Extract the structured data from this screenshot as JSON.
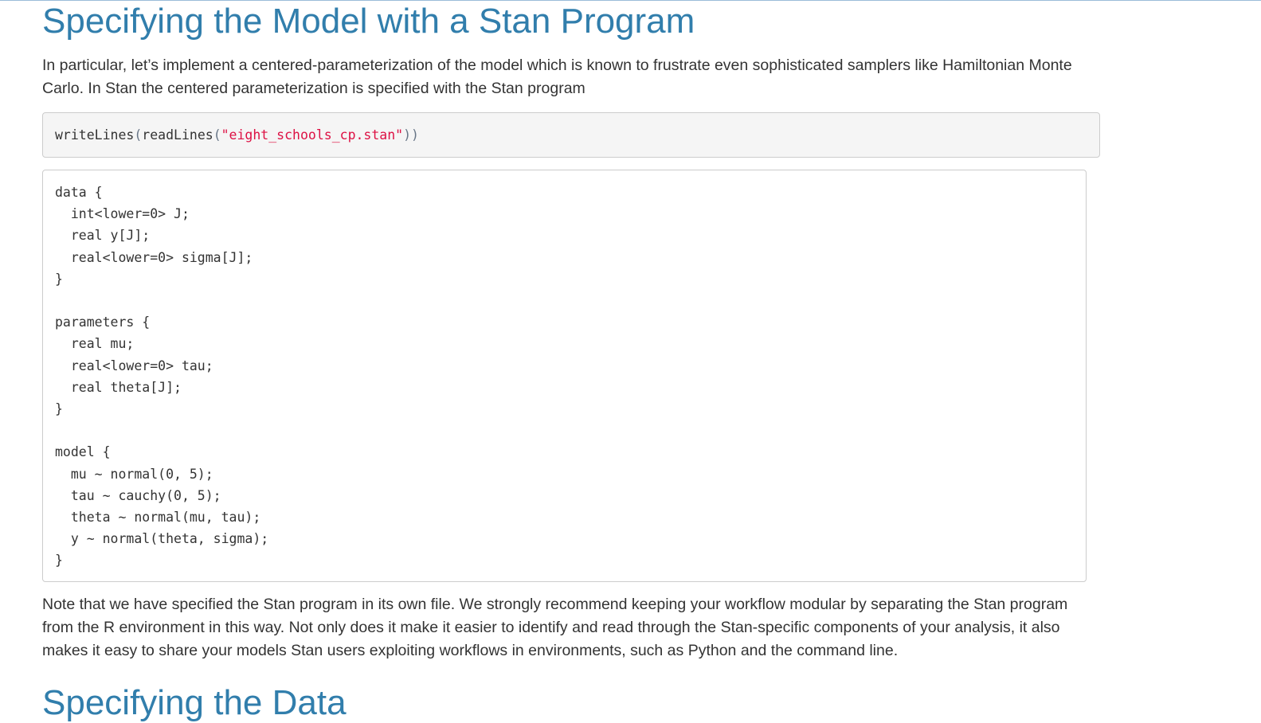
{
  "title": "Specifying the Model with a Stan Program",
  "intro": "In particular, let’s implement a centered-parameterization of the model which is known to frustrate even sophisticated samplers like Hamiltonian Monte Carlo. In Stan the centered parameterization is specified with the Stan program",
  "source_code": {
    "outer_fn": "writeLines",
    "open1": "(",
    "inner_fn": "readLines",
    "open2": "(",
    "string": "\"eight_schools_cp.stan\"",
    "close": "))"
  },
  "output_code": "data {\n  int<lower=0> J;\n  real y[J];\n  real<lower=0> sigma[J];\n}\n\nparameters {\n  real mu;\n  real<lower=0> tau;\n  real theta[J];\n}\n\nmodel {\n  mu ~ normal(0, 5);\n  tau ~ cauchy(0, 5);\n  theta ~ normal(mu, tau);\n  y ~ normal(theta, sigma);\n}",
  "note": "Note that we have specified the Stan program in its own file. We strongly recommend keeping your workflow modular by separating the Stan program from the R environment in this way. Not only does it make it easier to identify and read through the Stan-specific components of your analysis, it also makes it easy to share your models Stan users exploiting workflows in environments, such as Python and the command line.",
  "next_heading": "Specifying the Data"
}
